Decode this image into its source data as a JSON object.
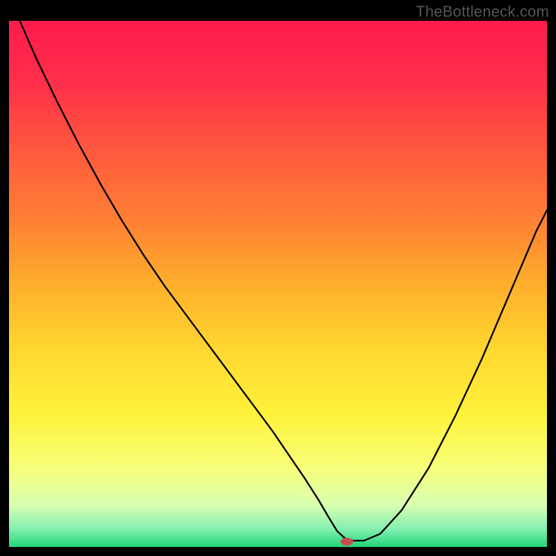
{
  "watermark": "TheBottleneck.com",
  "gradient": {
    "stops": [
      {
        "offset": 0.0,
        "color": "#ff1a4d"
      },
      {
        "offset": 0.12,
        "color": "#ff2f4a"
      },
      {
        "offset": 0.25,
        "color": "#ff5a3d"
      },
      {
        "offset": 0.38,
        "color": "#ff8033"
      },
      {
        "offset": 0.5,
        "color": "#ffae2b"
      },
      {
        "offset": 0.62,
        "color": "#ffd62f"
      },
      {
        "offset": 0.75,
        "color": "#fff23a"
      },
      {
        "offset": 0.85,
        "color": "#f7ff7a"
      },
      {
        "offset": 0.92,
        "color": "#d8ffb0"
      },
      {
        "offset": 0.965,
        "color": "#85f0b0"
      },
      {
        "offset": 1.0,
        "color": "#22d57a"
      }
    ]
  },
  "chart_data": {
    "type": "line",
    "title": "",
    "xlabel": "",
    "ylabel": "",
    "xlim": [
      0,
      100
    ],
    "ylim": [
      0,
      100
    ],
    "grid": false,
    "legend": false,
    "series": [
      {
        "name": "bottleneck-curve",
        "x": [
          2,
          5,
          9,
          13,
          17,
          21,
          25,
          29,
          33,
          37,
          41,
          45,
          49,
          52,
          55,
          57.5,
          59.5,
          61,
          62.5,
          64,
          66,
          69,
          73,
          78,
          83,
          88,
          93,
          98,
          100
        ],
        "y": [
          100,
          93,
          84.5,
          76.5,
          69,
          62,
          55.5,
          49.5,
          44,
          38.5,
          33,
          27.5,
          22,
          17.5,
          13,
          9,
          5.5,
          3,
          1.6,
          1.2,
          1.2,
          2.5,
          7,
          15,
          25,
          36,
          48,
          60,
          64
        ]
      }
    ],
    "marker": {
      "x": 62.8,
      "y": 1.0,
      "rx": 1.2,
      "ry": 0.75
    }
  }
}
